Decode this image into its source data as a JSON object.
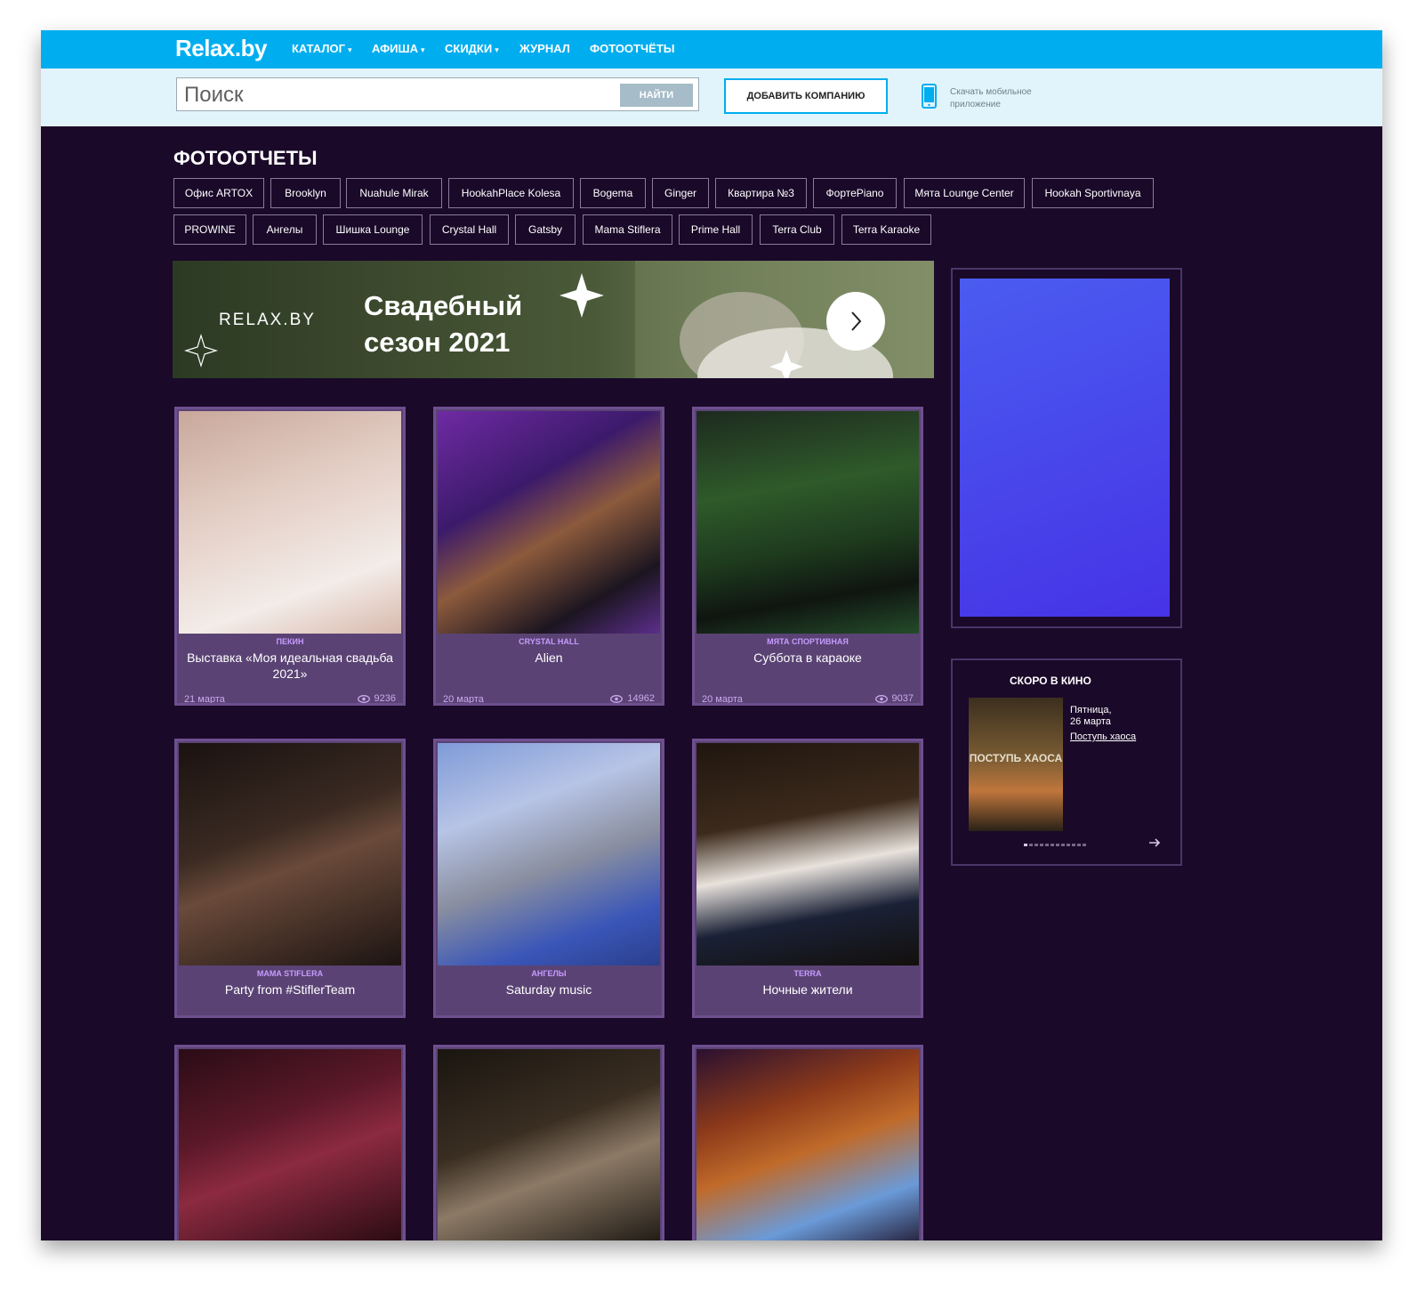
{
  "header": {
    "logo": "Relax.by",
    "nav": [
      {
        "label": "КАТАЛОГ",
        "has_dropdown": true
      },
      {
        "label": "АФИША",
        "has_dropdown": true
      },
      {
        "label": "СКИДКИ",
        "has_dropdown": true
      },
      {
        "label": "ЖУРНАЛ",
        "has_dropdown": false
      },
      {
        "label": "ФОТООТЧЁТЫ",
        "has_dropdown": false
      }
    ]
  },
  "search": {
    "placeholder": "Поиск",
    "button_label": "НАЙТИ",
    "add_company_label": "ДОБАВИТЬ КОМПАНИЮ",
    "app_text": "Скачать мобильное приложение"
  },
  "page": {
    "title": "ФОТООТЧЕТЫ",
    "tags_row1": [
      "Офис ARTOX",
      "Brooklyn",
      "Nuahule Mirak",
      "HookahPlace Kolesa",
      "Bogema",
      "Ginger",
      "Квартира №3",
      "ФортеPiano",
      "Мята Lounge Center",
      "Hookah Sportivnaya"
    ],
    "tags_row2": [
      "PROWINE",
      "Ангелы",
      "Шишка Lounge",
      "Crystal Hall",
      "Gatsby",
      "Mama Stiflera",
      "Prime Hall",
      "Terra Club",
      "Terra Karaoke"
    ]
  },
  "banner": {
    "brand": "RELAX.BY",
    "title": "Свадебный сезон 2021"
  },
  "cards": [
    {
      "venue": "ПЕКИН",
      "title": "Выставка «Моя идеальная свадьба 2021»",
      "date": "21 марта",
      "views": "9236"
    },
    {
      "venue": "CRYSTAL HALL",
      "title": "Alien",
      "date": "20 марта",
      "views": "14962"
    },
    {
      "venue": "МЯТА СПОРТИВНАЯ",
      "title": "Суббота в караоке",
      "date": "20 марта",
      "views": "9037"
    },
    {
      "venue": "MAMA STIFLERA",
      "title": "Party from #StiflerTeam",
      "date": "",
      "views": ""
    },
    {
      "venue": "АНГЕЛЫ",
      "title": "Saturday music",
      "date": "",
      "views": ""
    },
    {
      "venue": "TERRA",
      "title": "Ночные жители",
      "date": "",
      "views": ""
    }
  ],
  "sidebar": {
    "cinema_heading": "СКОРО В КИНО",
    "cinema_day": "Пятница,",
    "cinema_date": "26 марта",
    "cinema_film": "Поступь хаоса",
    "poster_title": "ПОСТУПЬ ХАОСА"
  },
  "colors": {
    "topbar": "#00aeef",
    "page_bg": "#1a0929",
    "card_bg": "#5a4374",
    "venue_accent": "#c79bff",
    "ad_blue": "#4a4cf0"
  }
}
